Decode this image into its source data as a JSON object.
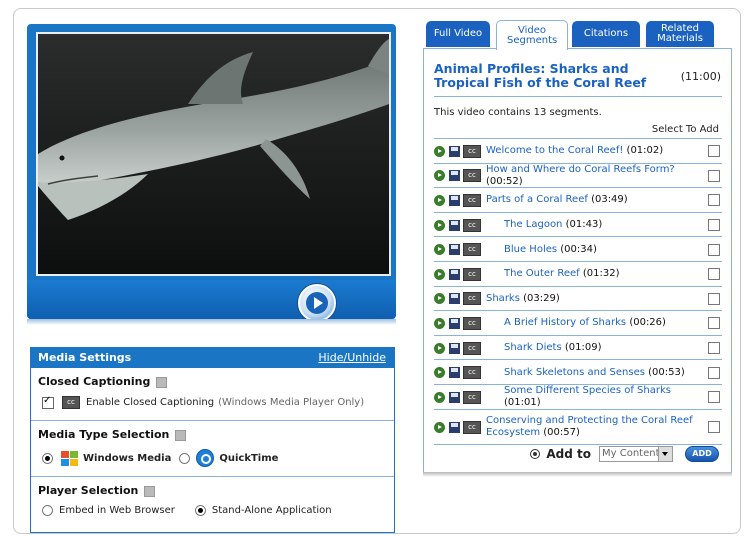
{
  "player": {
    "play_button_label": "Play"
  },
  "media_settings": {
    "header": "Media Settings",
    "hide_unhide": "Hide/Unhide",
    "closed_captioning": {
      "title": "Closed Captioning",
      "cc_label": "cc",
      "checkbox_label": "Enable Closed Captioning",
      "note": "(Windows Media Player Only)",
      "checked": true
    },
    "media_type": {
      "title": "Media Type Selection",
      "options": [
        "Windows Media",
        "QuickTime"
      ],
      "selected": "Windows Media"
    },
    "player_selection": {
      "title": "Player Selection",
      "options": [
        "Embed in Web Browser",
        "Stand-Alone Application"
      ],
      "selected": "Stand-Alone Application"
    }
  },
  "tabs": [
    "Full Video",
    "Video Segments",
    "Citations",
    "Related Materials"
  ],
  "active_tab": "Video Segments",
  "panel": {
    "title": "Animal Profiles: Sharks and Tropical Fish of the Coral Reef",
    "duration": "(11:00)",
    "contains_text": "This video contains 13 segments.",
    "select_to_add": "Select To Add",
    "segments": [
      {
        "title": "Welcome to the Coral Reef!",
        "duration": "(01:02)",
        "indent": false
      },
      {
        "title": "How and Where do Coral Reefs Form?",
        "duration": "(00:52)",
        "indent": false
      },
      {
        "title": "Parts of a Coral Reef",
        "duration": "(03:49)",
        "indent": false
      },
      {
        "title": "The Lagoon",
        "duration": "(01:43)",
        "indent": true
      },
      {
        "title": "Blue Holes",
        "duration": "(00:34)",
        "indent": true
      },
      {
        "title": "The Outer Reef",
        "duration": "(01:32)",
        "indent": true
      },
      {
        "title": "Sharks",
        "duration": "(03:29)",
        "indent": false
      },
      {
        "title": "A Brief History of Sharks",
        "duration": "(00:26)",
        "indent": true
      },
      {
        "title": "Shark Diets",
        "duration": "(01:09)",
        "indent": true
      },
      {
        "title": "Shark Skeletons and Senses",
        "duration": "(00:53)",
        "indent": true
      },
      {
        "title": "Some Different Species of Sharks",
        "duration": "(01:01)",
        "indent": true
      },
      {
        "title": "Conserving and Protecting the Coral Reef Ecosystem",
        "duration": "(00:57)",
        "indent": false
      }
    ],
    "add_to_label": "Add to",
    "add_to_select": "My Content",
    "add_button": "ADD"
  },
  "colors": {
    "brand_blue": "#1a76c4",
    "tab_blue": "#1b62c0",
    "play_green": "#3a7b2c"
  }
}
